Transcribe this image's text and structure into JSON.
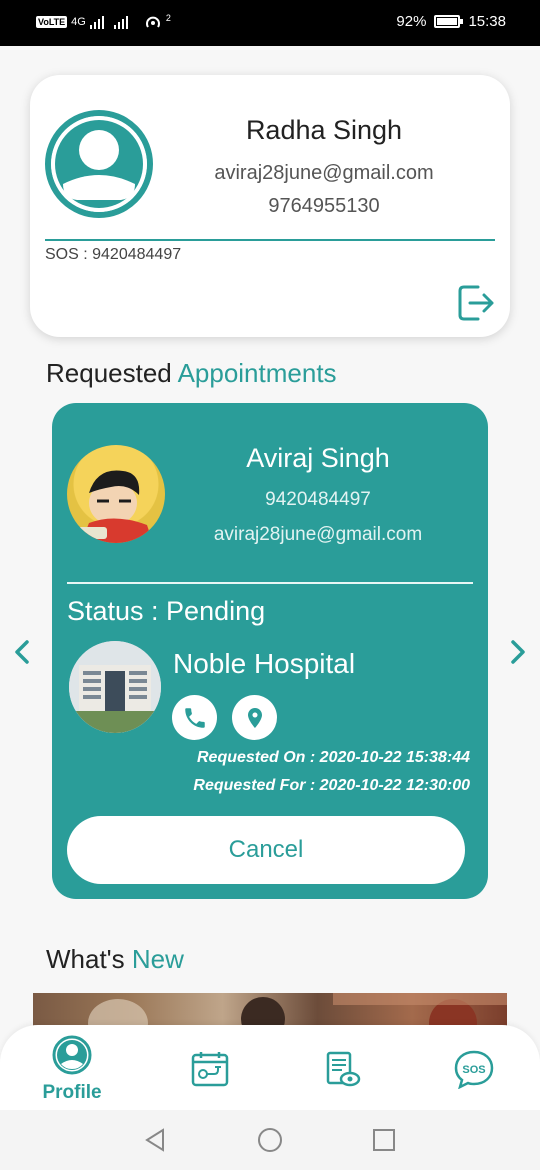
{
  "status_bar": {
    "volte": "VoLTE",
    "network": "4G",
    "signal_extra": "2",
    "battery": "92%",
    "time": "15:38"
  },
  "profile": {
    "name": "Radha Singh",
    "email": "aviraj28june@gmail.com",
    "phone": "9764955130",
    "sos": "SOS : 9420484497",
    "logout_icon": "logout-icon"
  },
  "appointments_section": {
    "title_plain": "Requested ",
    "title_accent": "Appointments"
  },
  "appointment": {
    "doctor_name": "Aviraj Singh",
    "doctor_phone": "9420484497",
    "doctor_email": "aviraj28june@gmail.com",
    "status": "Status : Pending",
    "hospital": "Noble Hospital",
    "requested_on": "Requested On : 2020-10-22 15:38:44",
    "requested_for": "Requested For : 2020-10-22 12:30:00",
    "cancel_label": "Cancel"
  },
  "whats_new": {
    "title_plain": "What's ",
    "title_accent": "New"
  },
  "bottom_nav": {
    "profile_label": "Profile",
    "items": [
      "profile-icon",
      "appointment-icon",
      "records-icon",
      "sos-icon"
    ]
  },
  "colors": {
    "accent": "#2a9d99",
    "background": "#f7f7f7",
    "card": "#ffffff"
  }
}
